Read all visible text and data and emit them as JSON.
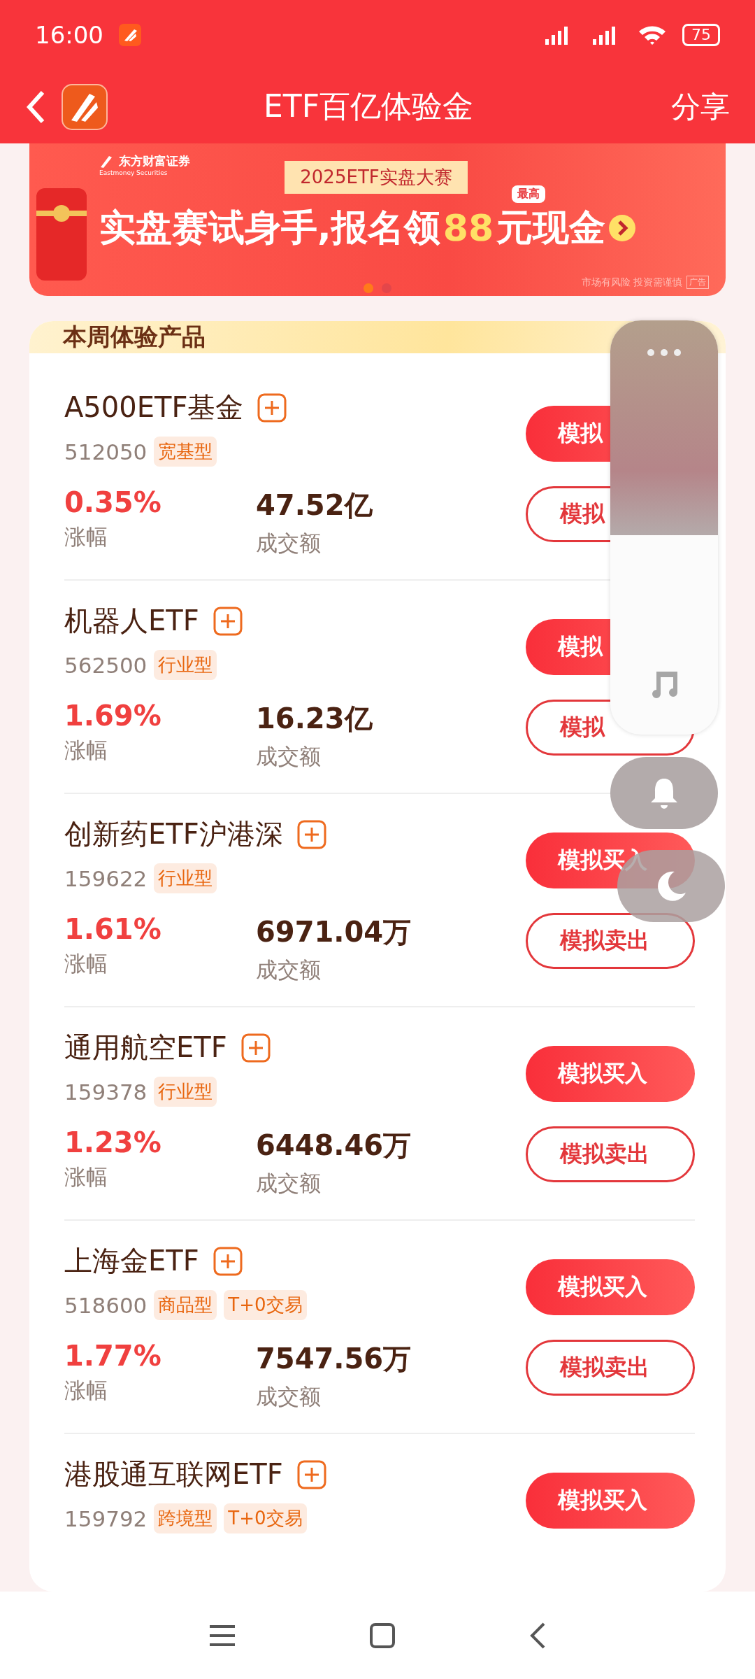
{
  "status_bar": {
    "time": "16:00",
    "battery": "75"
  },
  "header": {
    "title": "ETF百亿体验金",
    "share": "分享"
  },
  "banner": {
    "brand": "东方财富证券",
    "brand_en": "Eastmoney Securities",
    "contest": "2025ETF实盘大赛",
    "badge": "最高",
    "headline": [
      {
        "text": "实盘赛试身手,报名领",
        "highlight": false
      },
      {
        "text": "88",
        "highlight": true
      },
      {
        "text": "元现金",
        "highlight": false
      }
    ],
    "risk": "市场有风险 投资需谨慎",
    "ad": "广告",
    "dots": [
      {
        "selected": true
      },
      {
        "selected": false
      }
    ]
  },
  "section": {
    "title": "本周体验产品"
  },
  "products": [
    {
      "name": "A500ETF基金",
      "code": "512050",
      "tags": [
        "宽基型"
      ],
      "change": "0.35%",
      "change_label": "涨幅",
      "volume": "47.52亿",
      "volume_label": "成交额",
      "buy": "模拟",
      "sell": "模拟"
    },
    {
      "name": "机器人ETF",
      "code": "562500",
      "tags": [
        "行业型"
      ],
      "change": "1.69%",
      "change_label": "涨幅",
      "volume": "16.23亿",
      "volume_label": "成交额",
      "buy": "模拟",
      "sell": "模拟"
    },
    {
      "name": "创新药ETF沪港深",
      "code": "159622",
      "tags": [
        "行业型"
      ],
      "change": "1.61%",
      "change_label": "涨幅",
      "volume": "6971.04万",
      "volume_label": "成交额",
      "buy": "模拟买入",
      "sell": "模拟卖出"
    },
    {
      "name": "通用航空ETF",
      "code": "159378",
      "tags": [
        "行业型"
      ],
      "change": "1.23%",
      "change_label": "涨幅",
      "volume": "6448.46万",
      "volume_label": "成交额",
      "buy": "模拟买入",
      "sell": "模拟卖出"
    },
    {
      "name": "上海金ETF",
      "code": "518600",
      "tags": [
        "商品型",
        "T+0交易"
      ],
      "change": "1.77%",
      "change_label": "涨幅",
      "volume": "7547.56万",
      "volume_label": "成交额",
      "buy": "模拟买入",
      "sell": "模拟卖出"
    },
    {
      "name": "港股通互联网ETF",
      "code": "159792",
      "tags": [
        "跨境型",
        "T+0交易"
      ],
      "buy": "模拟买入"
    }
  ]
}
